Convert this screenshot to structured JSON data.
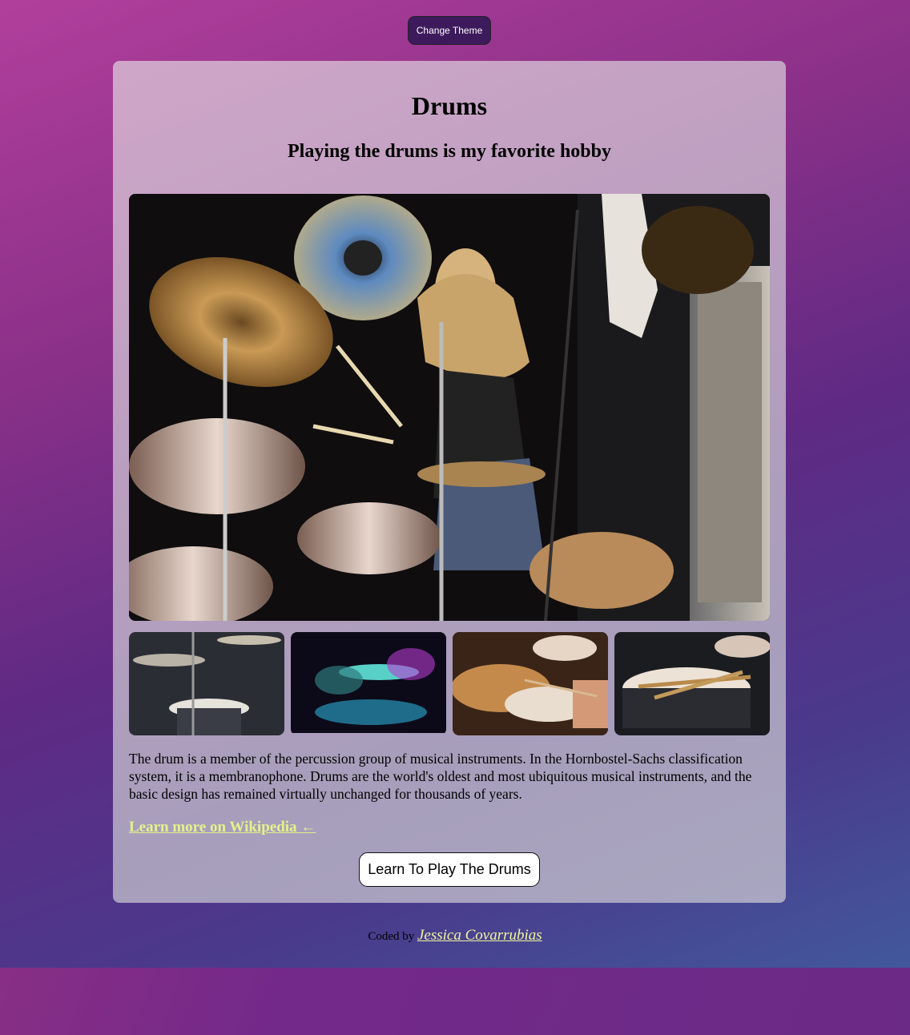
{
  "header": {
    "theme_button_label": "Change Theme"
  },
  "card": {
    "title": "Drums",
    "subtitle": "Playing the drums is my favorite hobby",
    "hero_image": "drummer-performing-on-stage",
    "thumbnails": [
      "drum-kit-cymbals-closeup",
      "drums-teal-stage-lights",
      "hands-playing-snare-and-cymbal",
      "drumsticks-on-snare"
    ],
    "description": "The drum is a member of the percussion group of musical instruments. In the Hornbostel-Sachs classification system, it is a membranophone. Drums are the world's oldest and most ubiquitous musical instruments, and the basic design has remained virtually unchanged for thousands of years.",
    "wiki_link": "Learn more on Wikipedia ←",
    "cta_button": "Learn To Play The Drums"
  },
  "footer": {
    "prefix": "Coded by ",
    "author": "Jessica Covarrubias"
  },
  "colors": {
    "accent_link": "#e4f28a",
    "button_dark": "#3d1a5c"
  }
}
